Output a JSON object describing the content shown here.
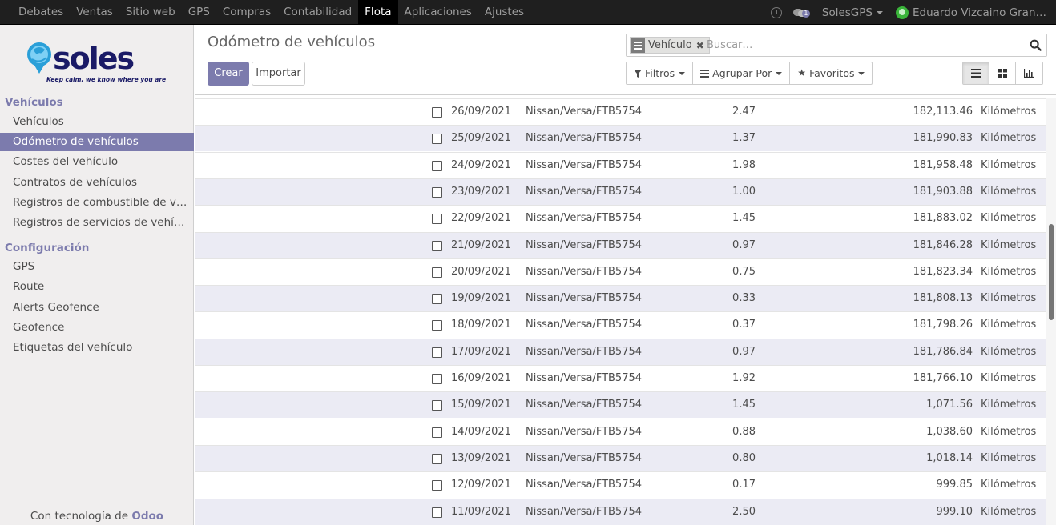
{
  "topbar": {
    "menu": [
      "Debates",
      "Ventas",
      "Sitio web",
      "GPS",
      "Compras",
      "Contabilidad",
      "Flota",
      "Aplicaciones",
      "Ajustes"
    ],
    "active": "Flota",
    "messages_count": "1",
    "company": "SolesGPS",
    "user": "Eduardo Vizcaino Gran…"
  },
  "sidebar": {
    "logo": {
      "name": "soles",
      "tagline": "Keep calm, we know where you are"
    },
    "section1": "Vehículos",
    "items1": [
      "Vehículos",
      "Odómetro de vehículos",
      "Costes del vehículo",
      "Contratos de vehículos",
      "Registros de combustible de v…",
      "Registros de servicios de vehí…"
    ],
    "section2": "Configuración",
    "items2": [
      "GPS",
      "Route",
      "Alerts Geofence",
      "Geofence",
      "Etiquetas del vehículo"
    ],
    "footer_prefix": "Con tecnología de",
    "footer_brand": "Odoo"
  },
  "control_panel": {
    "title": "Odómetro de vehículos",
    "create_label": "Crear",
    "import_label": "Importar",
    "facet_label": "Vehículo",
    "search_placeholder": "Buscar…",
    "filters_label": "Filtros",
    "groupby_label": "Agrupar Por",
    "favorites_label": "Favoritos"
  },
  "list": {
    "rows": [
      {
        "date": "26/09/2021",
        "vehicle": "Nissan/Versa/FTB5754",
        "value": "2.47",
        "odometer": "182,113.46",
        "unit": "Kilómetros"
      },
      {
        "date": "25/09/2021",
        "vehicle": "Nissan/Versa/FTB5754",
        "value": "1.37",
        "odometer": "181,990.83",
        "unit": "Kilómetros"
      },
      {
        "date": "24/09/2021",
        "vehicle": "Nissan/Versa/FTB5754",
        "value": "1.98",
        "odometer": "181,958.48",
        "unit": "Kilómetros"
      },
      {
        "date": "23/09/2021",
        "vehicle": "Nissan/Versa/FTB5754",
        "value": "1.00",
        "odometer": "181,903.88",
        "unit": "Kilómetros"
      },
      {
        "date": "22/09/2021",
        "vehicle": "Nissan/Versa/FTB5754",
        "value": "1.45",
        "odometer": "181,883.02",
        "unit": "Kilómetros"
      },
      {
        "date": "21/09/2021",
        "vehicle": "Nissan/Versa/FTB5754",
        "value": "0.97",
        "odometer": "181,846.28",
        "unit": "Kilómetros"
      },
      {
        "date": "20/09/2021",
        "vehicle": "Nissan/Versa/FTB5754",
        "value": "0.75",
        "odometer": "181,823.34",
        "unit": "Kilómetros"
      },
      {
        "date": "19/09/2021",
        "vehicle": "Nissan/Versa/FTB5754",
        "value": "0.33",
        "odometer": "181,808.13",
        "unit": "Kilómetros"
      },
      {
        "date": "18/09/2021",
        "vehicle": "Nissan/Versa/FTB5754",
        "value": "0.37",
        "odometer": "181,798.26",
        "unit": "Kilómetros"
      },
      {
        "date": "17/09/2021",
        "vehicle": "Nissan/Versa/FTB5754",
        "value": "0.97",
        "odometer": "181,786.84",
        "unit": "Kilómetros"
      },
      {
        "date": "16/09/2021",
        "vehicle": "Nissan/Versa/FTB5754",
        "value": "1.92",
        "odometer": "181,766.10",
        "unit": "Kilómetros"
      },
      {
        "date": "15/09/2021",
        "vehicle": "Nissan/Versa/FTB5754",
        "value": "1.45",
        "odometer": "1,071.56",
        "unit": "Kilómetros"
      },
      {
        "date": "14/09/2021",
        "vehicle": "Nissan/Versa/FTB5754",
        "value": "0.88",
        "odometer": "1,038.60",
        "unit": "Kilómetros"
      },
      {
        "date": "13/09/2021",
        "vehicle": "Nissan/Versa/FTB5754",
        "value": "0.80",
        "odometer": "1,018.14",
        "unit": "Kilómetros"
      },
      {
        "date": "12/09/2021",
        "vehicle": "Nissan/Versa/FTB5754",
        "value": "0.17",
        "odometer": "999.85",
        "unit": "Kilómetros"
      },
      {
        "date": "11/09/2021",
        "vehicle": "Nissan/Versa/FTB5754",
        "value": "2.50",
        "odometer": "999.10",
        "unit": "Kilómetros"
      }
    ]
  },
  "colors": {
    "accent": "#7c7bad",
    "topbar": "#1f1f1f",
    "odd_row": "#ebebf4"
  }
}
